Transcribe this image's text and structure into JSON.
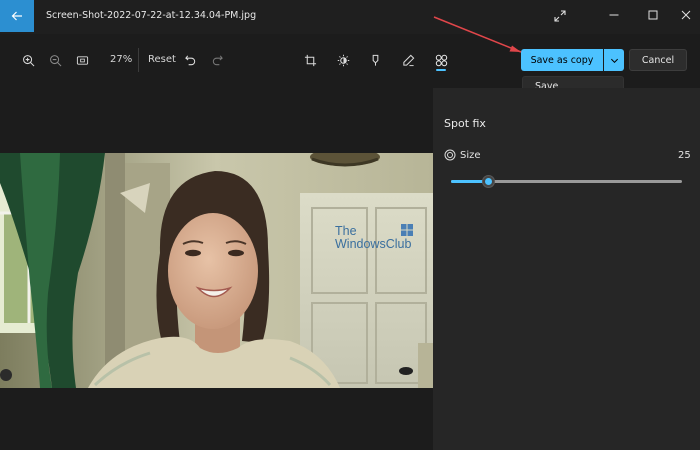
{
  "window": {
    "title": "Screen-Shot-2022-07-22-at-12.34.04-PM.jpg"
  },
  "toolbar": {
    "zoom_level": "27%",
    "reset_label": "Reset",
    "icons": [
      "zoom-in-icon",
      "zoom-out-icon",
      "fit-to-window-icon",
      "undo-icon",
      "redo-icon",
      "crop-icon",
      "brightness-icon",
      "markup-icon",
      "draw-icon",
      "retouch-icon"
    ],
    "active_tool": "retouch-icon"
  },
  "save_actions": {
    "save_as_copy_label": "Save as copy",
    "cancel_label": "Cancel",
    "dropdown_items": [
      "Save"
    ]
  },
  "photo": {
    "watermark_line1": "The",
    "watermark_line2": "WindowsClub"
  },
  "panel": {
    "title": "Spot fix",
    "size_label": "Size",
    "size_value": "25",
    "size_fraction": 0.16
  },
  "colors": {
    "accent": "#4cc2ff",
    "back_button": "#2c8fd1",
    "annotation_arrow": "#e0464a"
  }
}
